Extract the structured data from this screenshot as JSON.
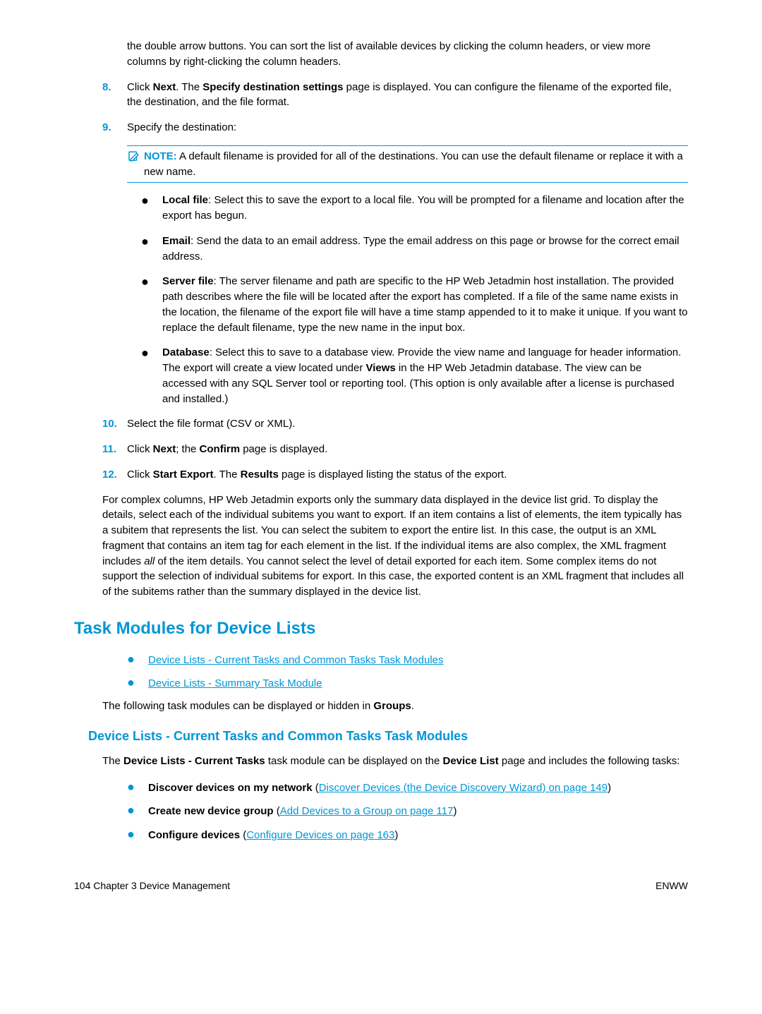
{
  "intro": "the double arrow buttons. You can sort the list of available devices by clicking the column headers, or view more columns by right-clicking the column headers.",
  "step8": {
    "num": "8.",
    "pre": "Click ",
    "b1": "Next",
    "mid": ". The ",
    "b2": "Specify destination settings",
    "post": " page is displayed. You can configure the filename of the exported file, the destination, and the file format."
  },
  "step9": {
    "num": "9.",
    "text": "Specify the destination:"
  },
  "note": {
    "label": "NOTE:",
    "text": "A default filename is provided for all of the destinations. You can use the default filename or replace it with a new name."
  },
  "bullets": {
    "local": {
      "label": "Local file",
      "text": ": Select this to save the export to a local file. You will be prompted for a filename and location after the export has begun."
    },
    "email": {
      "label": "Email",
      "text": ": Send the data to an email address. Type the email address on this page or browse for the correct email address."
    },
    "server": {
      "label": "Server file",
      "text": ": The server filename and path are specific to the HP Web Jetadmin host installation. The provided path describes where the file will be located after the export has completed. If a file of the same name exists in the location, the filename of the export file will have a time stamp appended to it to make it unique. If you want to replace the default filename, type the new name in the input box."
    },
    "database": {
      "label": "Database",
      "pre": ": Select this to save to a database view. Provide the view name and language for header information. The export will create a view located under ",
      "b": "Views",
      "post": " in the HP Web Jetadmin database. The view can be accessed with any SQL Server tool or reporting tool. (This option is only available after a license is purchased and installed.)"
    }
  },
  "step10": {
    "num": "10.",
    "text": "Select the file format (CSV or XML)."
  },
  "step11": {
    "num": "11.",
    "pre": "Click ",
    "b1": "Next",
    "mid": "; the ",
    "b2": "Confirm",
    "post": " page is displayed."
  },
  "step12": {
    "num": "12.",
    "pre": "Click ",
    "b1": "Start Export",
    "mid": ". The ",
    "b2": "Results",
    "post": " page is displayed listing the status of the export."
  },
  "body": {
    "p1a": "For complex columns, HP Web Jetadmin exports only the summary data displayed in the device list grid. To display the details, select each of the individual subitems you want to export. If an item contains a list of elements, the item typically has a subitem that represents the list. You can select the subitem to export the entire list. In this case, the output is an XML fragment that contains an item tag for each element in the list. If the individual items are also complex, the XML fragment includes ",
    "p1em": "all",
    "p1b": " of the item details. You cannot select the level of detail exported for each item. Some complex items do not support the selection of individual subitems for export. In this case, the exported content is an XML fragment that includes all of the subitems rather than the summary displayed in the device list."
  },
  "h2": "Task Modules for Device Lists",
  "links": {
    "l1": "Device Lists - Current Tasks and Common Tasks Task Modules",
    "l2": "Device Lists - Summary Task Module"
  },
  "linksPost": {
    "pre": "The following task modules can be displayed or hidden in ",
    "b": "Groups",
    "post": "."
  },
  "h3": "Device Lists - Current Tasks and Common Tasks Task Modules",
  "sec2": {
    "p1a": "The ",
    "p1b": "Device Lists - Current Tasks",
    "p1c": " task module can be displayed on the ",
    "p1d": "Device List",
    "p1e": " page and includes the following tasks:"
  },
  "tasks": {
    "t1": {
      "label": "Discover devices on my network",
      "paren_open": " (",
      "link": "Discover Devices (the Device Discovery Wizard) on page 149",
      "paren_close": ")"
    },
    "t2": {
      "label": "Create new device group",
      "paren_open": " (",
      "link": "Add Devices to a Group on page 117",
      "paren_close": ")"
    },
    "t3": {
      "label": "Configure devices",
      "paren_open": " (",
      "link": "Configure Devices on page 163",
      "paren_close": ")"
    }
  },
  "footer": {
    "left": "104   Chapter 3   Device Management",
    "right": "ENWW"
  }
}
